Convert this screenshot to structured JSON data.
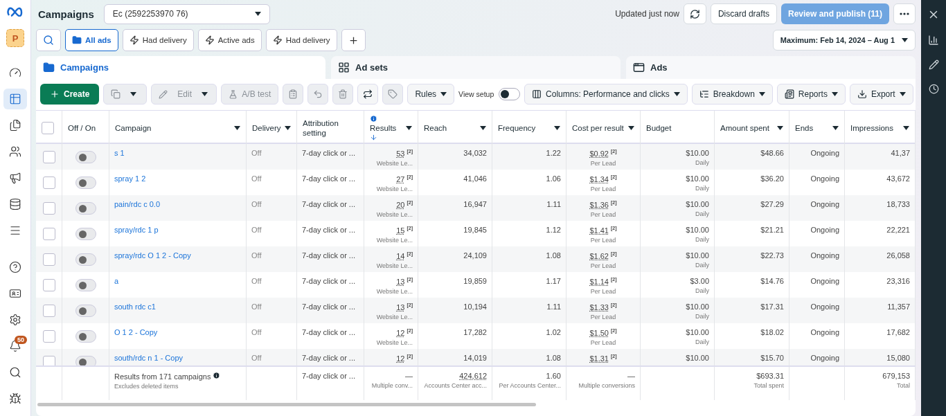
{
  "header": {
    "title": "Campaigns",
    "account": "Ec (2592253970 76)",
    "updated": "Updated just now",
    "discard": "Discard drafts",
    "publish": {
      "label": "Review and publish (11)",
      "disabled": true
    }
  },
  "sidebar": {
    "avatar": "P",
    "items": [
      {
        "kind": "gauge",
        "selected": false
      },
      {
        "kind": "table",
        "selected": true
      },
      {
        "kind": "pages",
        "selected": false
      },
      {
        "kind": "people",
        "selected": false
      },
      {
        "kind": "megaphone",
        "selected": false
      },
      {
        "kind": "coins",
        "selected": false
      },
      {
        "kind": "menu",
        "selected": false
      }
    ],
    "bottom": [
      {
        "kind": "help"
      },
      {
        "kind": "news"
      },
      {
        "kind": "settings"
      },
      {
        "kind": "bell",
        "badge": "50"
      },
      {
        "kind": "search"
      },
      {
        "kind": "bug"
      }
    ]
  },
  "filters": [
    {
      "label": "All ads",
      "kind": "folder",
      "selected": true
    },
    {
      "label": "Had delivery",
      "kind": "bolt",
      "selected": false
    },
    {
      "label": "Active ads",
      "kind": "bolt",
      "selected": false
    },
    {
      "label": "Had delivery",
      "kind": "bolt",
      "selected": false
    }
  ],
  "date_range": "Maximum: Feb 14, 2024 – Aug 1",
  "tabs": [
    {
      "label": "Campaigns",
      "kind": "campaigns",
      "selected": true
    },
    {
      "label": "Ad sets",
      "kind": "adsets",
      "selected": false
    },
    {
      "label": "Ads",
      "kind": "ads",
      "selected": false
    }
  ],
  "toolbar": {
    "create": "Create",
    "edit": {
      "label": "Edit",
      "disabled": true
    },
    "ab_test": {
      "label": "A/B test",
      "disabled": true
    },
    "rules": "Rules",
    "view_setup": {
      "label": "View setup",
      "on": false
    },
    "columns": "Columns: Performance and clicks",
    "breakdown": "Breakdown",
    "reports": "Reports",
    "export": "Export"
  },
  "table": {
    "all_selected": false,
    "columns": [
      {
        "label": "Off / On",
        "menu": false,
        "sorted": false
      },
      {
        "label": "Campaign",
        "menu": true,
        "sorted": false
      },
      {
        "label": "Delivery",
        "menu": true,
        "sorted": false
      },
      {
        "label": "Attribution setting",
        "menu": false,
        "sorted": false
      },
      {
        "label": "Results",
        "menu": true,
        "sorted": true
      },
      {
        "label": "Reach",
        "menu": true,
        "sorted": false
      },
      {
        "label": "Frequency",
        "menu": true,
        "sorted": false
      },
      {
        "label": "Cost per result",
        "menu": true,
        "sorted": false
      },
      {
        "label": "Budget",
        "menu": false,
        "sorted": false
      },
      {
        "label": "Amount spent",
        "menu": true,
        "sorted": false
      },
      {
        "label": "Ends",
        "menu": true,
        "sorted": false
      },
      {
        "label": "Impressions",
        "menu": true,
        "sorted": false
      }
    ],
    "rows": [
      {
        "selected": false,
        "on": false,
        "name": "s 1",
        "delivery": "Off",
        "attribution": "7-day click or ...",
        "results": "53",
        "results_mark": "[2]",
        "results_note": "Website Le...",
        "reach": "34,032",
        "frequency": "1.22",
        "cost": "$0.92",
        "cost_mark": "[2]",
        "cost_note": "Per Lead",
        "budget": "$10.00",
        "budget_note": "Daily",
        "spent": "$48.66",
        "ends": "Ongoing",
        "impressions": "41,37"
      },
      {
        "selected": false,
        "on": false,
        "name": "spray 1 2",
        "delivery": "Off",
        "attribution": "7-day click or ...",
        "results": "27",
        "results_mark": "[2]",
        "results_note": "Website Le...",
        "reach": "41,046",
        "frequency": "1.06",
        "cost": "$1.34",
        "cost_mark": "[2]",
        "cost_note": "Per Lead",
        "budget": "$10.00",
        "budget_note": "Daily",
        "spent": "$36.20",
        "ends": "Ongoing",
        "impressions": "43,672"
      },
      {
        "selected": false,
        "on": false,
        "name": "pain/rdc c 0.0",
        "delivery": "Off",
        "attribution": "7-day click or ...",
        "results": "20",
        "results_mark": "[2]",
        "results_note": "Website Le...",
        "reach": "16,947",
        "frequency": "1.11",
        "cost": "$1.36",
        "cost_mark": "[2]",
        "cost_note": "Per Lead",
        "budget": "$10.00",
        "budget_note": "Daily",
        "spent": "$27.29",
        "ends": "Ongoing",
        "impressions": "18,733"
      },
      {
        "selected": false,
        "on": false,
        "name": "spray/rdc 1 p",
        "delivery": "Off",
        "attribution": "7-day click or ...",
        "results": "15",
        "results_mark": "[2]",
        "results_note": "Website Le...",
        "reach": "19,845",
        "frequency": "1.12",
        "cost": "$1.41",
        "cost_mark": "[2]",
        "cost_note": "Per Lead",
        "budget": "$10.00",
        "budget_note": "Daily",
        "spent": "$21.21",
        "ends": "Ongoing",
        "impressions": "22,221"
      },
      {
        "selected": false,
        "on": false,
        "name": "spray/rdc O 1 2 - Copy",
        "delivery": "Off",
        "attribution": "7-day click or ...",
        "results": "14",
        "results_mark": "[2]",
        "results_note": "Website Le...",
        "reach": "24,109",
        "frequency": "1.08",
        "cost": "$1.62",
        "cost_mark": "[2]",
        "cost_note": "Per Lead",
        "budget": "$10.00",
        "budget_note": "Daily",
        "spent": "$22.73",
        "ends": "Ongoing",
        "impressions": "26,058"
      },
      {
        "selected": false,
        "on": false,
        "name": "a",
        "delivery": "Off",
        "attribution": "7-day click or ...",
        "results": "13",
        "results_mark": "[2]",
        "results_note": "Website Le...",
        "reach": "19,859",
        "frequency": "1.17",
        "cost": "$1.14",
        "cost_mark": "[2]",
        "cost_note": "Per Lead",
        "budget": "$3.00",
        "budget_note": "Daily",
        "spent": "$14.76",
        "ends": "Ongoing",
        "impressions": "23,316"
      },
      {
        "selected": false,
        "on": false,
        "name": "south rdc c1",
        "delivery": "Off",
        "attribution": "7-day click or ...",
        "results": "13",
        "results_mark": "[2]",
        "results_note": "Website Le...",
        "reach": "10,194",
        "frequency": "1.11",
        "cost": "$1.33",
        "cost_mark": "[2]",
        "cost_note": "Per Lead",
        "budget": "$10.00",
        "budget_note": "Daily",
        "spent": "$17.31",
        "ends": "Ongoing",
        "impressions": "11,357"
      },
      {
        "selected": false,
        "on": false,
        "name": "O 1 2 - Copy",
        "delivery": "Off",
        "attribution": "7-day click or ...",
        "results": "12",
        "results_mark": "[2]",
        "results_note": "Website Le...",
        "reach": "17,282",
        "frequency": "1.02",
        "cost": "$1.50",
        "cost_mark": "[2]",
        "cost_note": "Per Lead",
        "budget": "$10.00",
        "budget_note": "Daily",
        "spent": "$18.02",
        "ends": "Ongoing",
        "impressions": "17,682"
      },
      {
        "selected": false,
        "on": false,
        "name": "south/rdc n 1 - Copy",
        "delivery": "Off",
        "attribution": "7-day click or ...",
        "results": "12",
        "results_mark": "[2]",
        "reach": "14,019",
        "frequency": "1.08",
        "cost": "$1.31",
        "cost_mark": "[2]",
        "budget": "$10.00",
        "spent": "$15.70",
        "ends": "Ongoing",
        "impressions": "15,080"
      }
    ],
    "footer": {
      "title": "Results from 171 campaigns",
      "subtitle": "Excludes deleted items",
      "attribution": "7-day click or ...",
      "results": "—",
      "results_note": "Multiple conv...",
      "reach": "424,612",
      "reach_note": "Accounts Center acc...",
      "frequency": "1.60",
      "frequency_note": "Per Accounts Center...",
      "cost": "—",
      "cost_note": "Multiple conversions",
      "spent": "$693.31",
      "spent_note": "Total spent",
      "impressions": "679,153",
      "impressions_note": "Total"
    }
  }
}
